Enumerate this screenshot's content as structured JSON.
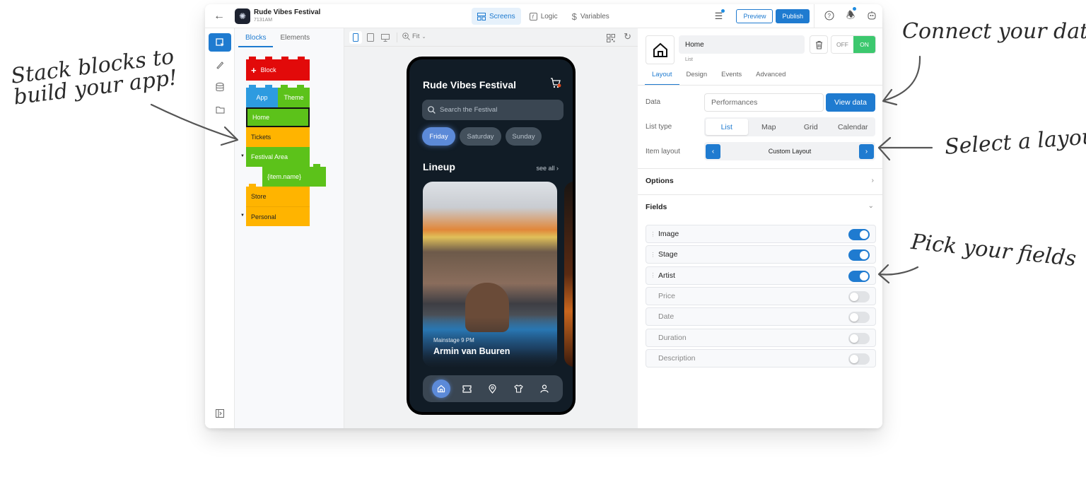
{
  "annotations": {
    "stack_blocks_line1": "Stack blocks to",
    "stack_blocks_line2": "build your app!",
    "connect_data": "Connect your data",
    "select_layout": "Select a layout",
    "pick_fields": "Pick your fields"
  },
  "topbar": {
    "back_icon": "arrow-left-icon",
    "app_name": "Rude Vibes Festival",
    "app_subtitle": "7131AM",
    "tabs": [
      {
        "label": "Screens",
        "icon": "screens-icon",
        "active": true
      },
      {
        "label": "Logic",
        "icon": "function-icon",
        "active": false
      },
      {
        "label": "Variables",
        "icon": "dollar-icon",
        "active": false
      }
    ],
    "preview_label": "Preview",
    "publish_label": "Publish"
  },
  "left_panel": {
    "tabs": [
      {
        "label": "Blocks",
        "active": true
      },
      {
        "label": "Elements",
        "active": false
      }
    ],
    "add_block_label": "Block",
    "blocks": {
      "app": "App",
      "theme": "Theme",
      "home": "Home",
      "tickets": "Tickets",
      "festival_area": "Festival Area",
      "item_name": "{item.name}",
      "store": "Store",
      "personal": "Personal"
    }
  },
  "canvas": {
    "zoom_label": "Fit"
  },
  "phone": {
    "title": "Rude Vibes Festival",
    "search_placeholder": "Search the Festival",
    "day_chips": [
      {
        "label": "Friday",
        "active": true
      },
      {
        "label": "Saturday",
        "active": false
      },
      {
        "label": "Sunday",
        "active": false
      }
    ],
    "section_title": "Lineup",
    "see_all": "see all",
    "card": {
      "subtitle": "Mainstage 9 PM",
      "artist": "Armin van Buuren"
    },
    "nav": [
      "home",
      "ticket",
      "location",
      "shirt",
      "user"
    ]
  },
  "properties": {
    "component_name": "Home",
    "component_type": "List",
    "off_label": "OFF",
    "on_label": "ON",
    "toggle_state": "ON",
    "tabs": [
      {
        "label": "Layout",
        "active": true
      },
      {
        "label": "Design",
        "active": false
      },
      {
        "label": "Events",
        "active": false
      },
      {
        "label": "Advanced",
        "active": false
      }
    ],
    "data_label": "Data",
    "data_value": "Performances",
    "view_data_label": "View data",
    "list_type_label": "List type",
    "list_types": [
      {
        "label": "List",
        "active": true
      },
      {
        "label": "Map",
        "active": false
      },
      {
        "label": "Grid",
        "active": false
      },
      {
        "label": "Calendar",
        "active": false
      }
    ],
    "item_layout_label": "Item layout",
    "item_layout_value": "Custom Layout",
    "options_label": "Options",
    "fields_label": "Fields",
    "fields": [
      {
        "name": "Image",
        "enabled": true
      },
      {
        "name": "Stage",
        "enabled": true
      },
      {
        "name": "Artist",
        "enabled": true
      },
      {
        "name": "Price",
        "enabled": false
      },
      {
        "name": "Date",
        "enabled": false
      },
      {
        "name": "Duration",
        "enabled": false
      },
      {
        "name": "Description",
        "enabled": false
      }
    ]
  },
  "colors": {
    "accent": "#1f7bd0",
    "on_green": "#3cc86e",
    "block_red": "#e20a0a",
    "block_blue": "#2d9be0",
    "block_green": "#5cc21a",
    "block_orange": "#ffb400",
    "phone_bg": "#111c26",
    "phone_accent": "#5c8ad8"
  }
}
